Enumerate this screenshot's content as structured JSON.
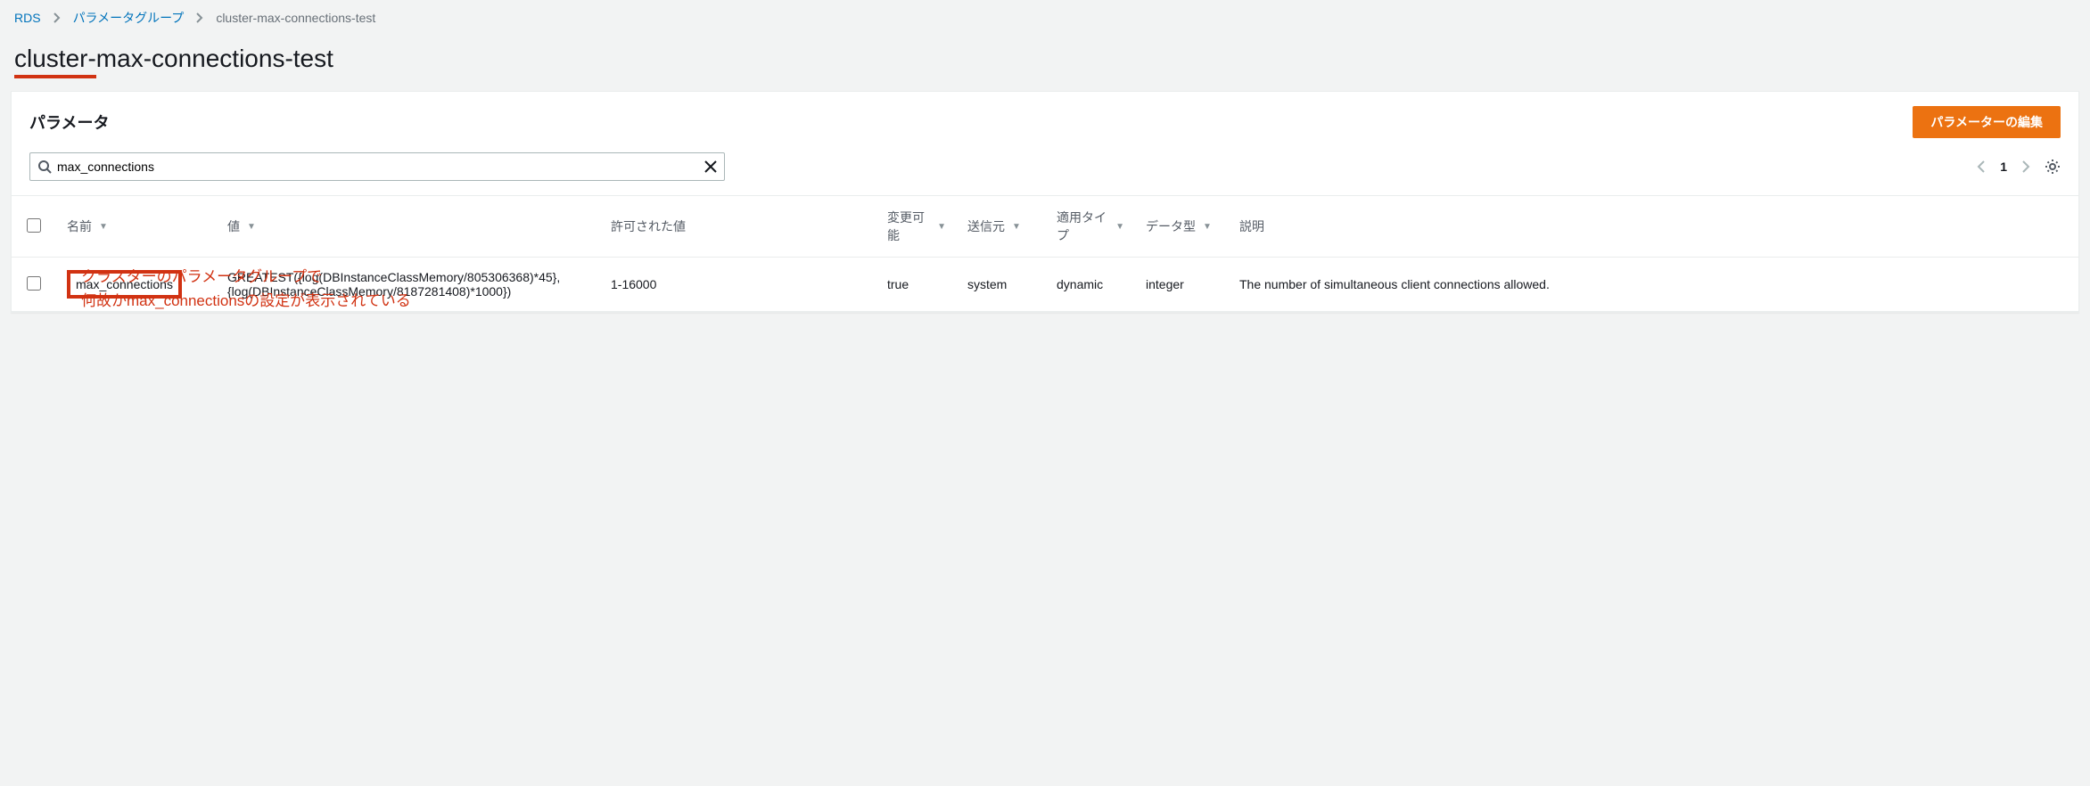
{
  "breadcrumb": {
    "root": "RDS",
    "group": "パラメータグループ",
    "current": "cluster-max-connections-test"
  },
  "page_title": "cluster-max-connections-test",
  "panel": {
    "heading": "パラメータ",
    "edit_label": "パラメーターの編集"
  },
  "search": {
    "value": "max_connections",
    "placeholder": ""
  },
  "pager": {
    "page": "1"
  },
  "columns": {
    "name": "名前",
    "value": "値",
    "allowed": "許可された値",
    "modifiable": "変更可能",
    "source": "送信元",
    "apply_type": "適用タイプ",
    "data_type": "データ型",
    "description": "説明"
  },
  "rows": [
    {
      "name": "max_connections",
      "value": "GREATEST({log(DBInstanceClassMemory/805306368)*45},{log(DBInstanceClassMemory/8187281408)*1000})",
      "allowed": "1-16000",
      "modifiable": "true",
      "source": "system",
      "apply_type": "dynamic",
      "data_type": "integer",
      "description": "The number of simultaneous client connections allowed."
    }
  ],
  "annotation": {
    "line1": "クラスターのパラメータグループで",
    "line2": "何故かmax_connectionsの設定が表示されている"
  }
}
